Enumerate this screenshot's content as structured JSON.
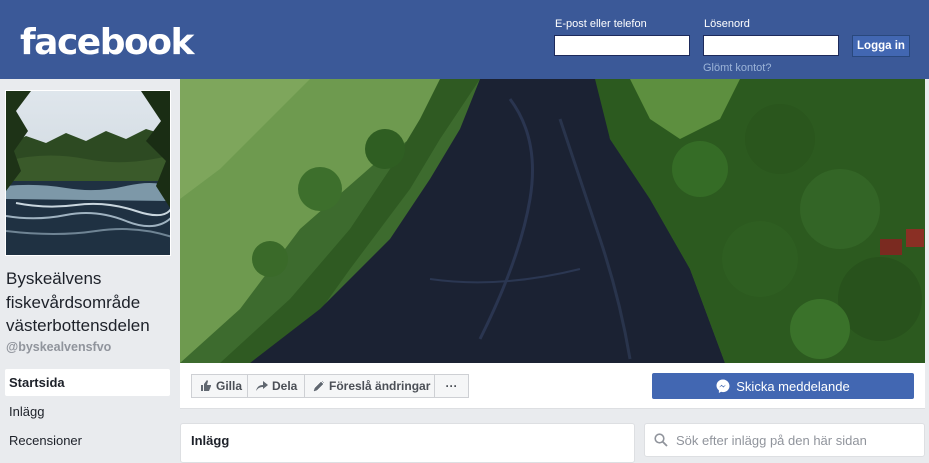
{
  "header": {
    "logo": "facebook",
    "email_label": "E-post eller telefon",
    "password_label": "Lösenord",
    "login_button": "Logga in",
    "forgot_link": "Glömt kontot?"
  },
  "page": {
    "name": "Byskeälvens fiskevårdsområde västerbottensdelen",
    "handle": "@byskealvensfvo"
  },
  "sidebar": {
    "items": [
      {
        "label": "Startsida",
        "active": true
      },
      {
        "label": "Inlägg",
        "active": false
      },
      {
        "label": "Recensioner",
        "active": false
      }
    ]
  },
  "actions": {
    "like": "Gilla",
    "share": "Dela",
    "suggest": "Föreslå ändringar",
    "more": "···",
    "send_message": "Skicka meddelande"
  },
  "posts": {
    "title": "Inlägg",
    "search_placeholder": "Sök efter inlägg på den här sidan"
  },
  "colors": {
    "brand": "#3b5998",
    "button": "#4267b2",
    "background": "#e9ebee"
  }
}
